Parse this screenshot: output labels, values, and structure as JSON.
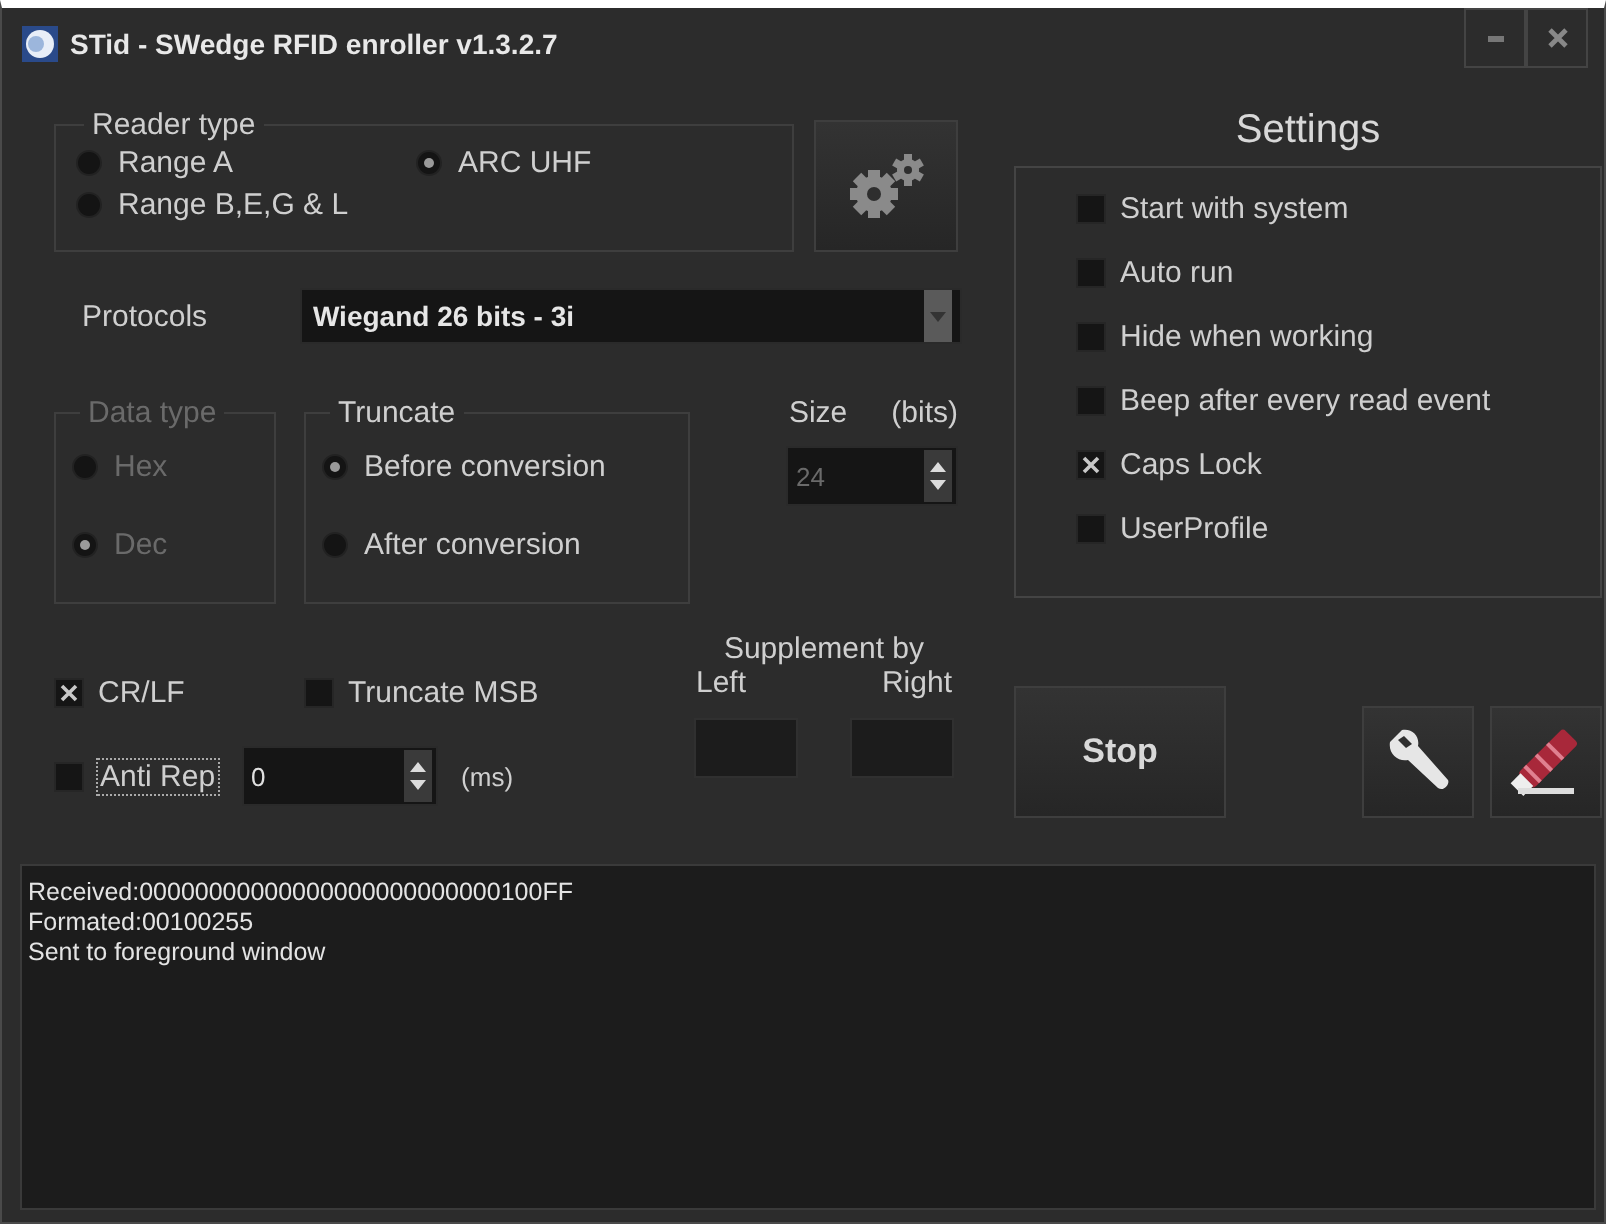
{
  "window": {
    "title": "STid - SWedge RFID enroller v1.3.2.7"
  },
  "reader_type": {
    "label": "Reader type",
    "options": [
      {
        "label": "Range A",
        "selected": false
      },
      {
        "label": "ARC UHF",
        "selected": true
      },
      {
        "label": "Range B,E,G & L",
        "selected": false
      }
    ]
  },
  "protocols": {
    "label": "Protocols",
    "value": "Wiegand 26 bits - 3i"
  },
  "data_type": {
    "label": "Data type",
    "disabled": true,
    "options": [
      {
        "label": "Hex",
        "selected": false
      },
      {
        "label": "Dec",
        "selected": true
      }
    ]
  },
  "truncate": {
    "label": "Truncate",
    "options": [
      {
        "label": "Before conversion",
        "selected": true
      },
      {
        "label": "After conversion",
        "selected": false
      }
    ]
  },
  "size": {
    "label": "Size",
    "unit": "(bits)",
    "value": "24",
    "disabled": true
  },
  "options": [
    {
      "label": "CR/LF",
      "checked": true
    },
    {
      "label": "Truncate MSB",
      "checked": false
    }
  ],
  "anti_rep": {
    "label": "Anti Rep",
    "checked": false,
    "focused": true,
    "value": "0",
    "unit": "(ms)"
  },
  "supplement": {
    "label": "Supplement by",
    "left_label": "Left",
    "right_label": "Right"
  },
  "settings": {
    "title": "Settings",
    "items": [
      {
        "label": "Start with system",
        "checked": false
      },
      {
        "label": "Auto run",
        "checked": false
      },
      {
        "label": "Hide when working",
        "checked": false
      },
      {
        "label": "Beep after every read event",
        "checked": false
      },
      {
        "label": "Caps Lock",
        "checked": true
      },
      {
        "label": "UserProfile",
        "checked": false
      }
    ]
  },
  "stop_button": {
    "label": "Stop"
  },
  "log": {
    "lines": [
      "Received:00000000000000000000000000100FF",
      "Formated:00100255",
      "Sent to foreground window"
    ]
  }
}
